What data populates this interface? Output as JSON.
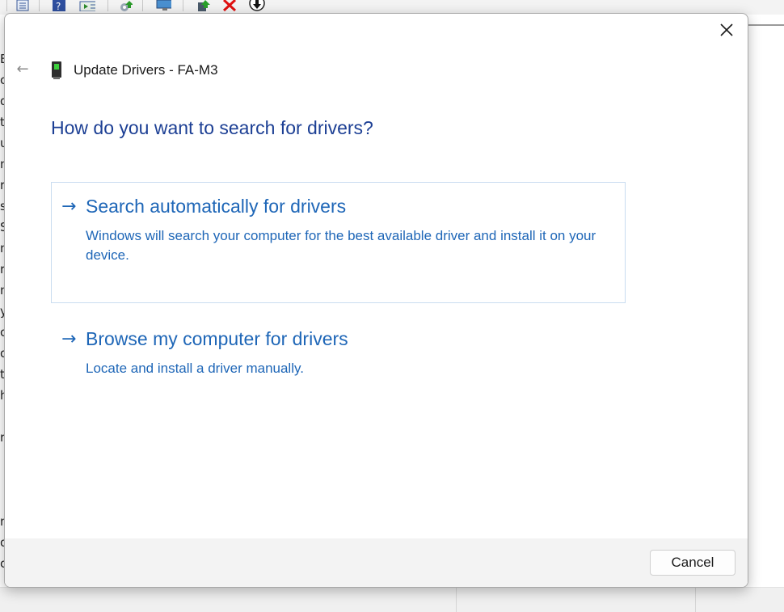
{
  "toolbar": {
    "icons": [
      "properties-icon",
      "help-icon",
      "action-icon",
      "scan-hardware-icon",
      "display-icon",
      "update-driver-icon",
      "uninstall-icon",
      "disable-icon"
    ]
  },
  "background_tree": {
    "fragments": [
      "B",
      "c",
      "d",
      "t",
      "u",
      "n",
      "r",
      "s",
      "S",
      "n",
      "r",
      "n",
      "y",
      "c",
      "o",
      "t",
      "h",
      "",
      "r",
      "",
      "",
      "",
      "n",
      "o",
      "c"
    ]
  },
  "dialog": {
    "title": "Update Drivers - FA-M3",
    "heading": "How do you want to search for drivers?",
    "options": [
      {
        "arrow": "→",
        "title": "Search automatically for drivers",
        "description": "Windows will search your computer for the best available driver and install it on your device."
      },
      {
        "arrow": "→",
        "title": "Browse my computer for drivers",
        "description": "Locate and install a driver manually."
      }
    ],
    "cancel_label": "Cancel",
    "back_icon": "←",
    "close_icon": "close-icon"
  },
  "colors": {
    "heading": "#1c3f94",
    "link": "#1e66b7",
    "option_border": "#c9dcf0",
    "footer_bg": "#f3f3f3"
  }
}
